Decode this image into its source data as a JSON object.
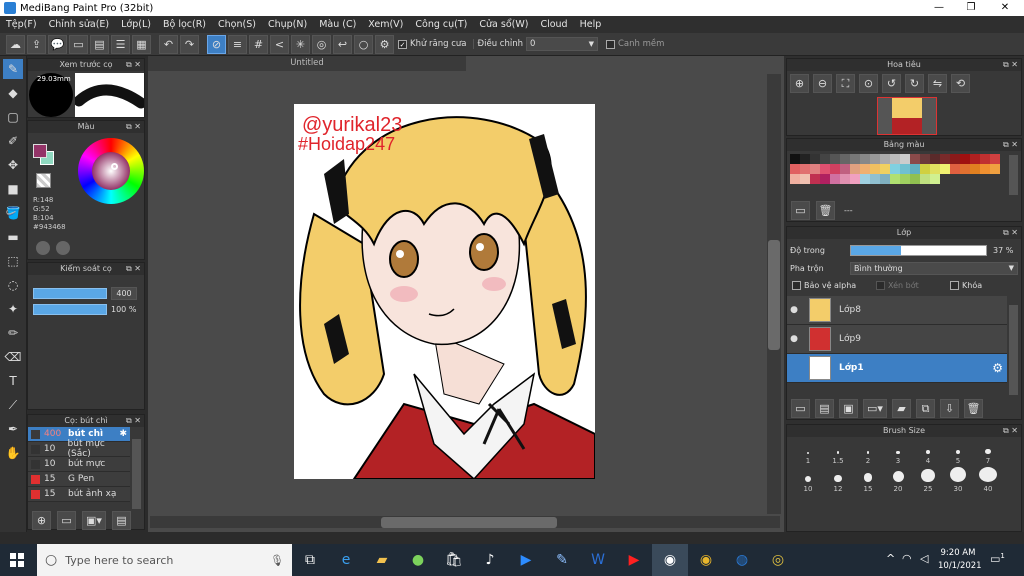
{
  "titlebar": {
    "title": "MediBang Paint Pro (32bit)",
    "minimize": "—",
    "restore": "❐",
    "close": "✕"
  },
  "menu": [
    "Tệp(F)",
    "Chỉnh sửa(E)",
    "Lớp(L)",
    "Bộ lọc(R)",
    "Chọn(S)",
    "Chụp(N)",
    "Màu (C)",
    "Xem(V)",
    "Công cụ(T)",
    "Cửa sổ(W)",
    "Cloud",
    "Help"
  ],
  "toolbar": {
    "antialias_label": "Khử răng cưa",
    "correction_label": "Điều chỉnh",
    "correction_value": "0",
    "snap_label": "Canh mềm"
  },
  "preview_panel": {
    "title": "Xem trước cọ",
    "size": "29.03mm"
  },
  "color_panel": {
    "title": "Màu",
    "r": "R:148",
    "g": "G:52",
    "b": "B:104",
    "hex": "#943468",
    "fg": "#943468",
    "bg": "#8fd9c0"
  },
  "brush_control": {
    "title": "Kiểm soát cọ",
    "size": "400",
    "opacity": "100 %"
  },
  "brush_list": {
    "title": "Cọ: bút chì",
    "items": [
      {
        "size": "400",
        "name": "bút chì",
        "color": "#3a3a3a"
      },
      {
        "size": "10",
        "name": "bút mực (Sắc)",
        "color": "#3a3a3a"
      },
      {
        "size": "10",
        "name": "bút mực",
        "color": "#3a3a3a"
      },
      {
        "size": "15",
        "name": "G Pen",
        "color": "#e03030"
      },
      {
        "size": "15",
        "name": "bút ảnh xạ",
        "color": "#e03030"
      }
    ]
  },
  "canvas": {
    "tab": "Untitled",
    "watermark_1": "@yurikal23",
    "watermark_2": "#Hoidap247"
  },
  "navigator": {
    "title": "Hoa tiêu"
  },
  "palette": {
    "title": "Bảng màu",
    "colors": [
      "#111",
      "#222",
      "#333",
      "#444",
      "#555",
      "#666",
      "#777",
      "#888",
      "#999",
      "#aaa",
      "#bbb",
      "#ccc",
      "#8a4a4a",
      "#6b3a3a",
      "#5a2a2a",
      "#7a2a2a",
      "#8b1a1a",
      "#a01010",
      "#b02020",
      "#c03030",
      "#d04040",
      "#e06060",
      "#e07070",
      "#e08080",
      "#e05070",
      "#d04060",
      "#c06080",
      "#e0a080",
      "#f0b070",
      "#f0c060",
      "#f0d060",
      "#80d0e0",
      "#70c0d0",
      "#60b0c0",
      "#d0d040",
      "#e0e060",
      "#f0f070",
      "#e06040",
      "#e07030",
      "#e08020",
      "#f09030",
      "#f0a040",
      "#f0b0a0",
      "#f0c0b0",
      "#c03050",
      "#b02060",
      "#d070a0",
      "#e090b0",
      "#f0a0c0",
      "#a0d0e0",
      "#90c0d0",
      "#80b0c0",
      "#b0e070",
      "#a0d060",
      "#90c050",
      "#c0e080",
      "#d0f090"
    ],
    "label": "---"
  },
  "layers": {
    "title": "Lớp",
    "opacity_label": "Độ trong",
    "opacity_value": "37 %",
    "opacity_fraction": 0.37,
    "blend_label": "Pha trộn",
    "blend_value": "Bình thường",
    "protect_alpha": "Bảo vệ alpha",
    "clipping": "Xén bớt",
    "lock": "Khóa",
    "items": [
      {
        "name": "Lớp8"
      },
      {
        "name": "Lớp9"
      },
      {
        "name": "Lớp1"
      }
    ]
  },
  "brush_size": {
    "title": "Brush Size",
    "sizes": [
      "1",
      "1.5",
      "2",
      "3",
      "4",
      "5",
      "7",
      "10",
      "12",
      "15",
      "20",
      "25",
      "30",
      "40"
    ]
  },
  "taskbar": {
    "search_placeholder": "Type here to search",
    "time": "9:20 AM",
    "date": "10/1/2021",
    "notif_count": "1"
  }
}
